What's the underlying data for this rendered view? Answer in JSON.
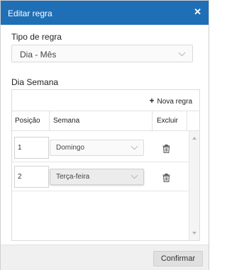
{
  "dialog": {
    "title": "Editar regra",
    "close_icon": "close-icon"
  },
  "rule_type": {
    "label": "Tipo de regra",
    "value": "Dia - Mês"
  },
  "weekday": {
    "label": "Dia Semana",
    "add_button": "Nova regra",
    "columns": {
      "position": "Posição",
      "week": "Semana",
      "delete": "Excluir"
    },
    "rows": [
      {
        "position": "1",
        "week": "Domingo"
      },
      {
        "position": "2",
        "week": "Terça-feira"
      }
    ]
  },
  "footer": {
    "confirm": "Confirmar"
  }
}
